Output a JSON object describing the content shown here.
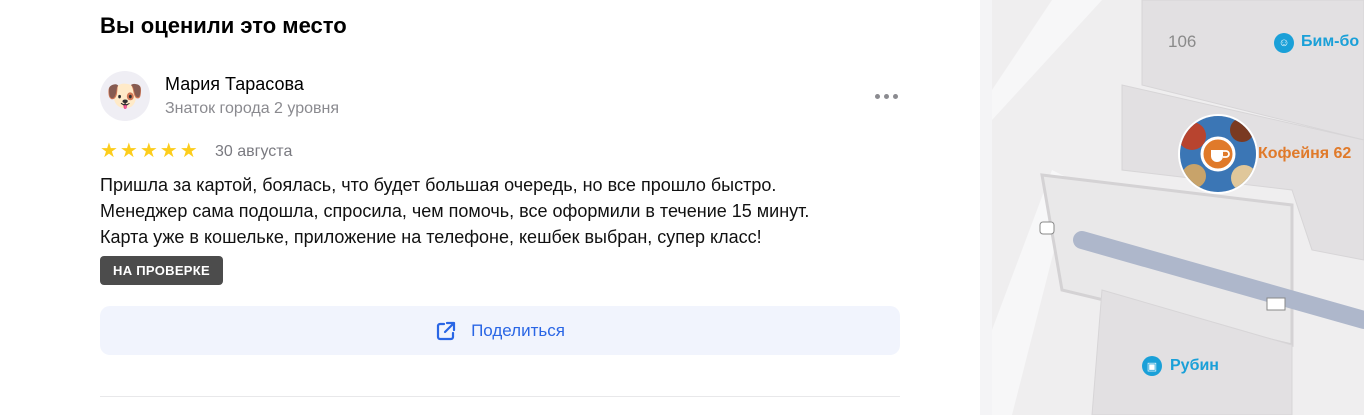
{
  "review": {
    "heading": "Вы оценили это место",
    "author": {
      "name": "Мария Тарасова",
      "level": "Знаток города 2 уровня",
      "avatar_icon": "dog-emoji-avatar",
      "avatar_glyph": "🐶"
    },
    "rating": 5,
    "stars_text": "★★★★★",
    "date": "30 августа",
    "text_lines": [
      "Пришла за картой, боялась, что будет большая очередь, но все прошло быстро.",
      "Менеджер сама подошла, спросила, чем помочь, все оформили в течение 15 минут.",
      "Карта уже в кошельке, приложение на телефоне, кешбек выбран, супер класс!"
    ],
    "status_badge": "НА ПРОВЕРКЕ",
    "share_label": "Поделиться",
    "more_icon": "more-dots-icon"
  },
  "map": {
    "house_number": "106",
    "pois": [
      {
        "label": "Бим-бо",
        "icon": "toy-store-icon",
        "color": "#1aa0d8"
      },
      {
        "label": "Кофейня 62",
        "icon": "coffee-icon",
        "color": "#e07a2a"
      },
      {
        "label": "Рубин",
        "icon": "shopping-bag-icon",
        "color": "#1aa0d8"
      }
    ]
  },
  "colors": {
    "accent": "#2a66e5",
    "star": "#fccd1c",
    "badge_bg": "#4c4c4c"
  }
}
